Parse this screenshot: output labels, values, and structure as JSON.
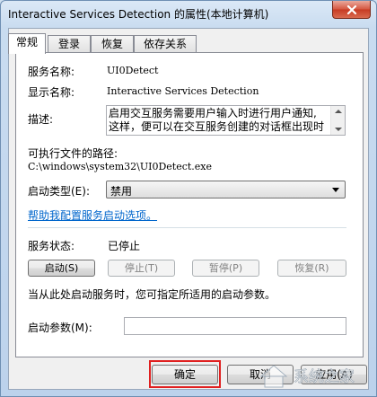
{
  "window": {
    "title": "Interactive Services Detection 的属性(本地计算机)"
  },
  "tabs": [
    {
      "label": "常规"
    },
    {
      "label": "登录"
    },
    {
      "label": "恢复"
    },
    {
      "label": "依存关系"
    }
  ],
  "general": {
    "service_name_label": "服务名称:",
    "service_name": "UI0Detect",
    "display_name_label": "显示名称:",
    "display_name": "Interactive Services Detection",
    "description_label": "描述:",
    "description": "启用交互服务需要用户输入时进行用户通知,\n这样，便可以在交互服务创建的对话框出现时",
    "path_label": "可执行文件的路径:",
    "path": "C:\\windows\\system32\\UI0Detect.exe",
    "startup_type_label": "启动类型(E):",
    "startup_type": "禁用",
    "help_link": "帮助我配置服务启动选项。",
    "status_label": "服务状态:",
    "status": "已停止",
    "start_button": "启动(S)",
    "stop_button": "停止(T)",
    "pause_button": "暂停(P)",
    "resume_button": "恢复(R)",
    "start_params_hint": "当从此处启动服务时，您可指定所适用的启动参数。",
    "start_params_label": "启动参数(M):",
    "start_params_value": ""
  },
  "footer": {
    "ok_button": "确定",
    "cancel_button": "取消",
    "apply_button": "应用(A)"
  },
  "watermark": {
    "text": "系统之家"
  },
  "colors": {
    "link": "#0066cc",
    "highlight": "#e02020",
    "close_button": "#c73a22"
  }
}
